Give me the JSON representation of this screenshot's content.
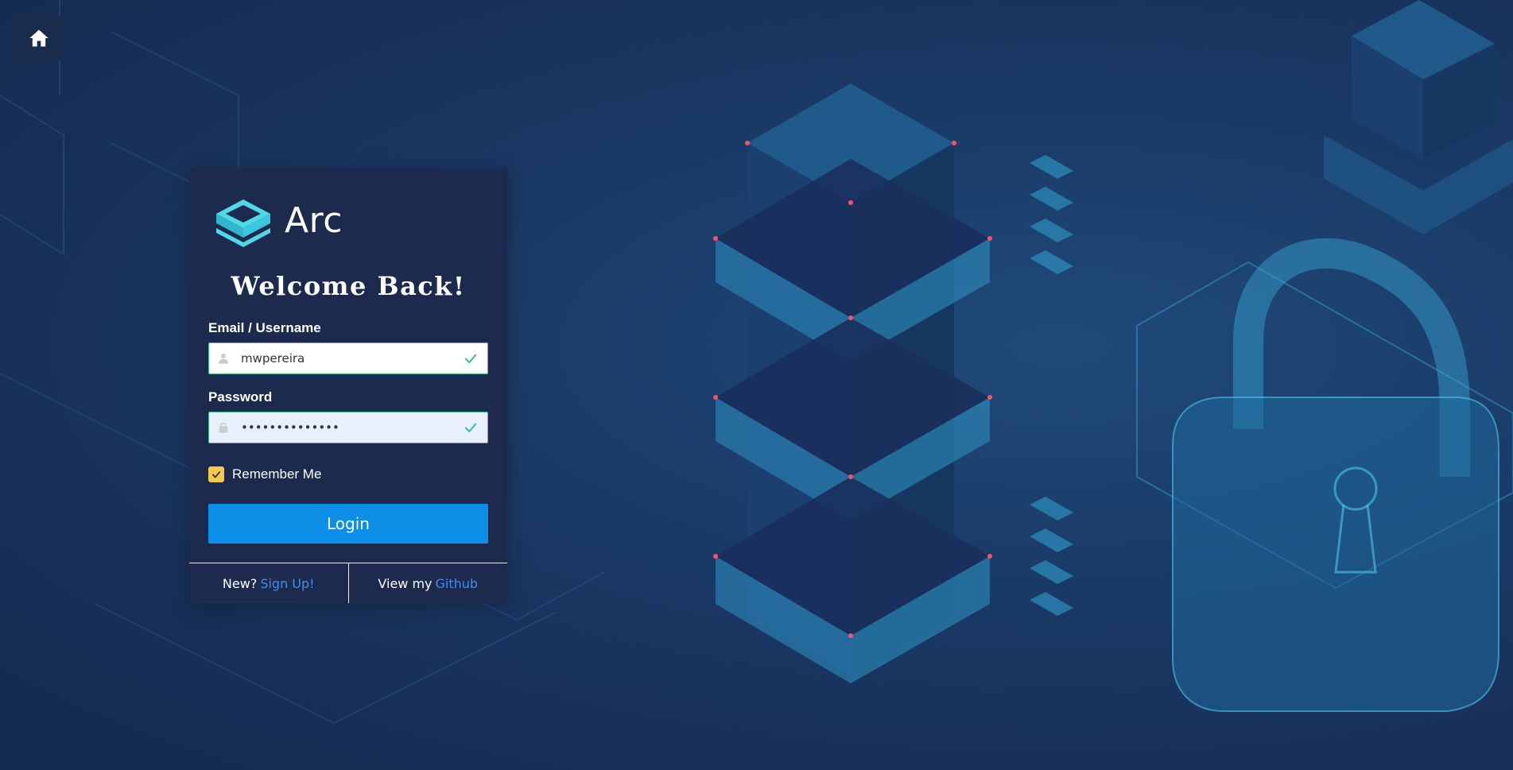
{
  "brand": {
    "name": "Arc",
    "accent": "#4fd8e8"
  },
  "header": {
    "home_icon": "home-icon"
  },
  "login": {
    "title": "Welcome Back!",
    "email_label": "Email / Username",
    "email_value": "mwpereira",
    "email_icon": "user-icon",
    "password_label": "Password",
    "password_value": "••••••••••••••",
    "password_icon": "lock-icon",
    "valid_icon": "check-icon",
    "remember_label": "Remember Me",
    "remember_checked": true,
    "login_button": "Login"
  },
  "footer": {
    "new_text": "New?",
    "signup_link": "Sign Up!",
    "github_text": "View my",
    "github_link": "Github"
  },
  "colors": {
    "background": "#1a3a66",
    "card": "#1b2a4d",
    "button": "#0d8fe8",
    "link": "#3f8ef0",
    "valid": "#3ec08a",
    "checkbox": "#f4c84a"
  }
}
